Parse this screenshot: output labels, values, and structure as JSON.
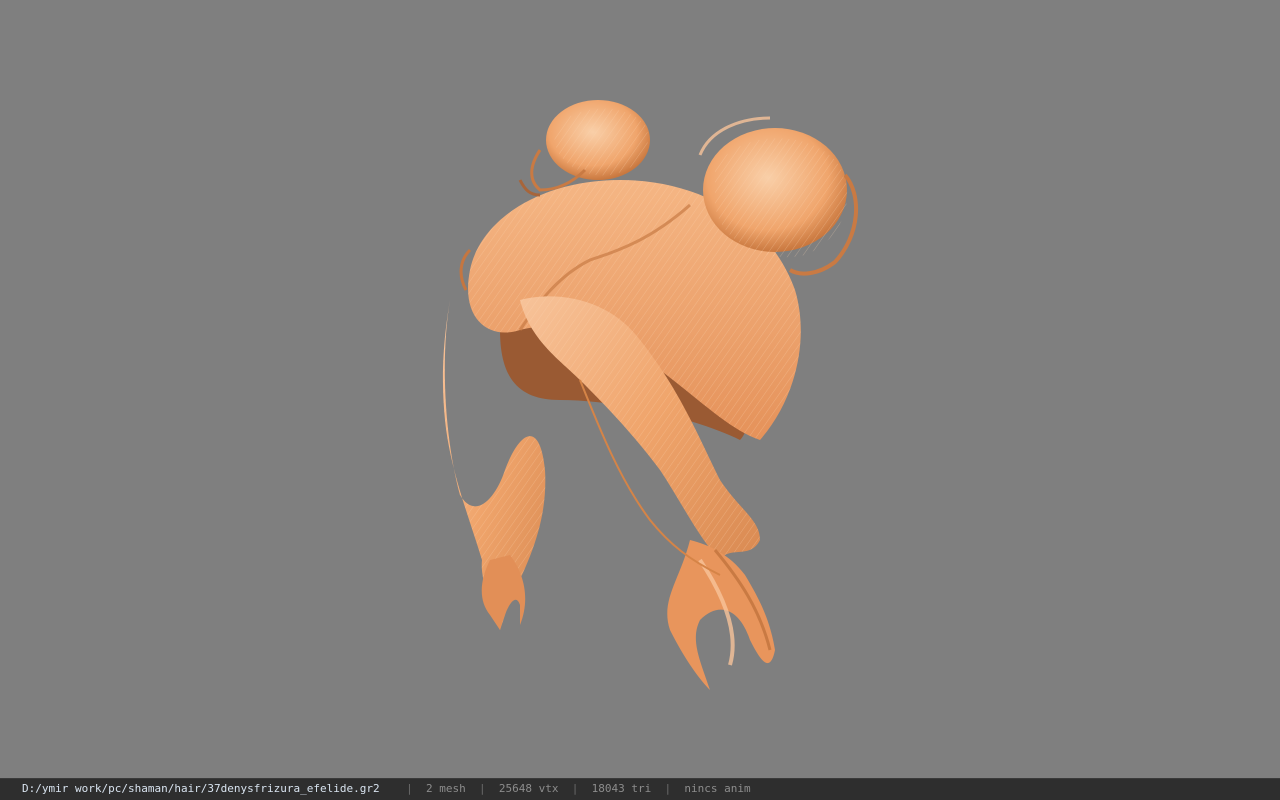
{
  "viewport": {
    "background_color": "#7f7f7f",
    "model": {
      "name": "hair-model",
      "base_color": "#f0a56c",
      "highlight_color": "#f7c39a",
      "shadow_color": "#9a5a33"
    }
  },
  "statusbar": {
    "file_path": "D:/ymir work/pc/shaman/hair/37denysfrizura_efelide.gr2",
    "separator": "|",
    "mesh_count": "2 mesh",
    "vertex_count": "25648 vtx",
    "triangle_count": "18043 tri",
    "animation_status": "nincs anim"
  }
}
